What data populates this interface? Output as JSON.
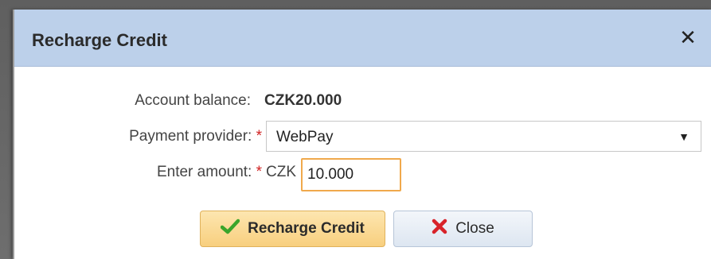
{
  "dialog": {
    "title": "Recharge Credit",
    "close_symbol": "✕"
  },
  "form": {
    "balance_label": "Account balance:",
    "balance_value": "CZK20.000",
    "provider_label": "Payment provider:",
    "provider_required": "*",
    "provider_value": "WebPay",
    "amount_label": "Enter amount:",
    "amount_required": "*",
    "amount_currency": "CZK",
    "amount_value": "10.000"
  },
  "buttons": {
    "recharge_label": "Recharge Credit",
    "recharge_icon": "checkmark-icon",
    "close_label": "Close",
    "close_icon": "red-x-icon"
  },
  "colors": {
    "titlebar": "#bcd0ea",
    "required": "#d02020",
    "input_focus": "#f0a94c",
    "primary_button": "#f8cf7e",
    "check": "#3aa52b",
    "close_x": "#d8232a"
  }
}
